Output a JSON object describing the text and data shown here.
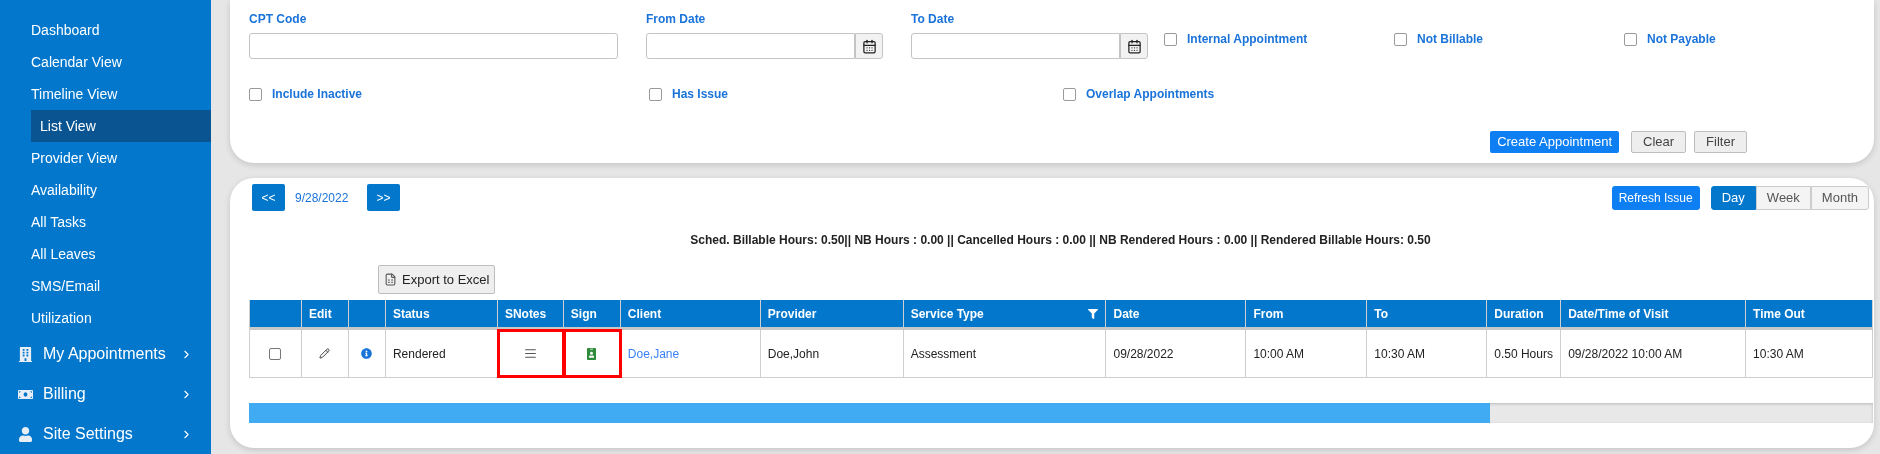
{
  "sidebar": {
    "items": [
      {
        "label": "Dashboard",
        "selected": false,
        "kind": "sub"
      },
      {
        "label": "Calendar View",
        "selected": false,
        "kind": "sub"
      },
      {
        "label": "Timeline View",
        "selected": false,
        "kind": "sub"
      },
      {
        "label": "List View",
        "selected": true,
        "kind": "sub"
      },
      {
        "label": "Provider View",
        "selected": false,
        "kind": "sub"
      },
      {
        "label": "Availability",
        "selected": false,
        "kind": "sub"
      },
      {
        "label": "All Tasks",
        "selected": false,
        "kind": "sub"
      },
      {
        "label": "All Leaves",
        "selected": false,
        "kind": "sub"
      },
      {
        "label": "SMS/Email",
        "selected": false,
        "kind": "sub"
      },
      {
        "label": "Utilization",
        "selected": false,
        "kind": "sub"
      },
      {
        "label": "My Appointments",
        "selected": false,
        "kind": "building"
      },
      {
        "label": "Billing",
        "selected": false,
        "kind": "money"
      },
      {
        "label": "Site Settings",
        "selected": false,
        "kind": "user"
      }
    ]
  },
  "filters": {
    "fields": [
      {
        "label": "CPT Code",
        "kind": "text"
      },
      {
        "label": "From Date",
        "kind": "date"
      },
      {
        "label": "To Date",
        "kind": "date"
      }
    ],
    "checkboxes_row1": [
      {
        "label": "Internal Appointment",
        "checked": false
      },
      {
        "label": "Not Billable",
        "checked": false
      },
      {
        "label": "Not Payable",
        "checked": false
      }
    ],
    "checkboxes_row2": [
      {
        "label": "Include Inactive",
        "checked": false
      },
      {
        "label": "Has Issue",
        "checked": false
      },
      {
        "label": "Overlap Appointments",
        "checked": false
      }
    ],
    "buttons": [
      {
        "label": "Create Appointment",
        "kind": "primary"
      },
      {
        "label": "Clear",
        "kind": "plain"
      },
      {
        "label": "Filter",
        "kind": "plain"
      }
    ]
  },
  "list": {
    "prev": "<<",
    "date": "9/28/2022",
    "next": ">>",
    "refresh": "Refresh Issue",
    "views": [
      {
        "label": "Day",
        "selected": true
      },
      {
        "label": "Week",
        "selected": false
      },
      {
        "label": "Month",
        "selected": false
      }
    ],
    "summary": "Sched. Billable Hours: 0.50|| NB Hours : 0.00 || Cancelled Hours : 0.00 || NB Rendered Hours : 0.00 || Rendered Billable Hours: 0.50",
    "export": "Export to Excel",
    "table": {
      "columns": [
        {
          "filterable": false
        },
        {
          "label": "Edit",
          "filterable": false
        },
        {
          "filterable": false
        },
        {
          "label": "Status",
          "filterable": false
        },
        {
          "label": "SNotes",
          "filterable": false
        },
        {
          "label": "Sign",
          "filterable": false
        },
        {
          "label": "Client",
          "filterable": false
        },
        {
          "label": "Provider",
          "filterable": false
        },
        {
          "label": "Service Type",
          "filterable": true
        },
        {
          "label": "Date",
          "filterable": false
        },
        {
          "label": "From",
          "filterable": false
        },
        {
          "label": "To",
          "filterable": false
        },
        {
          "label": "Duration",
          "filterable": false
        },
        {
          "label": "Date/Time of Visit",
          "filterable": false
        },
        {
          "label": "Time Out",
          "filterable": false
        }
      ],
      "rows": [
        {
          "cells": [
            {
              "kind": "checkbox",
              "checked": false,
              "highlighted": false
            },
            {
              "kind": "edit",
              "highlighted": false
            },
            {
              "kind": "info",
              "highlighted": false
            },
            {
              "kind": "text",
              "text": "Rendered",
              "highlighted": false
            },
            {
              "kind": "notes",
              "highlighted": true
            },
            {
              "kind": "sign",
              "highlighted": true
            },
            {
              "kind": "link",
              "text": "Doe,Jane",
              "highlighted": false
            },
            {
              "kind": "text",
              "text": "Doe,John",
              "highlighted": false
            },
            {
              "kind": "text",
              "text": "Assessment",
              "highlighted": false
            },
            {
              "kind": "text",
              "text": "09/28/2022",
              "highlighted": false
            },
            {
              "kind": "text",
              "text": "10:00 AM",
              "highlighted": false
            },
            {
              "kind": "text",
              "text": "10:30 AM",
              "highlighted": false
            },
            {
              "kind": "text",
              "text": "0.50 Hours",
              "highlighted": false
            },
            {
              "kind": "text",
              "text": "09/28/2022 10:00 AM",
              "highlighted": false
            },
            {
              "kind": "text",
              "text": "10:30 AM",
              "highlighted": false
            }
          ]
        }
      ]
    }
  }
}
